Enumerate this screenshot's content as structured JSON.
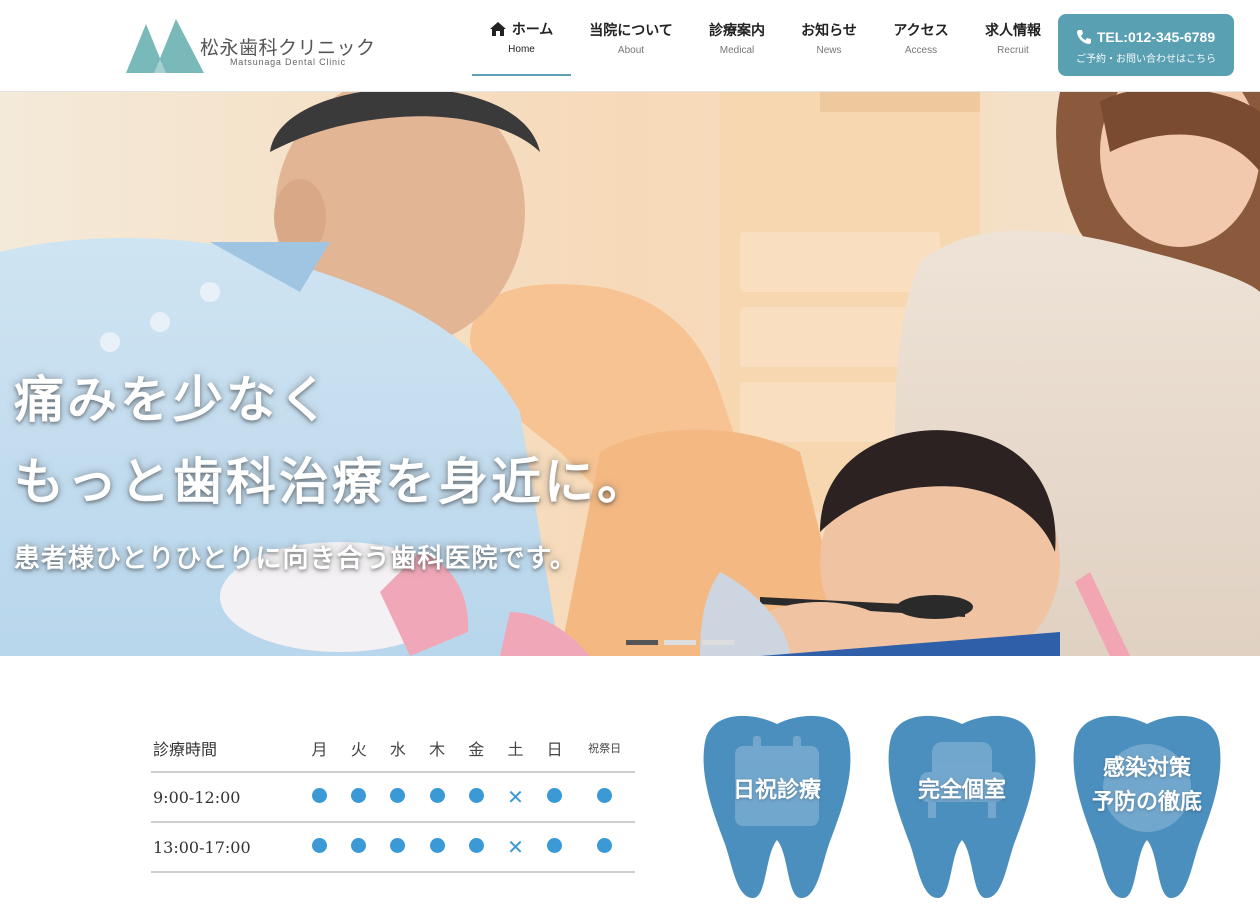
{
  "logo": {
    "name": "松永歯科クリニック",
    "sub": "Matsunaga Dental Clinic"
  },
  "nav": [
    {
      "jp": "ホーム",
      "en": "Home"
    },
    {
      "jp": "当院について",
      "en": "About"
    },
    {
      "jp": "診療案内",
      "en": "Medical"
    },
    {
      "jp": "お知らせ",
      "en": "News"
    },
    {
      "jp": "アクセス",
      "en": "Access"
    },
    {
      "jp": "求人情報",
      "en": "Recruit"
    }
  ],
  "tel": {
    "main": "TEL:012-345-6789",
    "sub": "ご予約・お問い合わせはこちら"
  },
  "hero": {
    "line1": "痛みを少なく",
    "line2": "もっと歯科治療を身近に。",
    "sub": "患者様ひとりひとりに向き合う歯科医院です。",
    "slides": 3,
    "active_slide": 1
  },
  "schedule": {
    "header": "診療時間",
    "days": [
      "月",
      "火",
      "水",
      "木",
      "金",
      "土",
      "日",
      "祝祭日"
    ],
    "rows": [
      {
        "time": "9:00-12:00",
        "open": [
          true,
          true,
          true,
          true,
          true,
          false,
          true,
          true
        ]
      },
      {
        "time": "13:00-17:00",
        "open": [
          true,
          true,
          true,
          true,
          true,
          false,
          true,
          true
        ]
      }
    ]
  },
  "features": [
    {
      "lines": [
        "日祝診療"
      ],
      "icon": "calendar-icon"
    },
    {
      "lines": [
        "完全個室"
      ],
      "icon": "chair-icon"
    },
    {
      "lines": [
        "感染対策",
        "予防の徹底"
      ],
      "icon": "shield-icon"
    }
  ],
  "colors": {
    "accent": "#59a0b3",
    "logo": "#79b9b9",
    "tooth": "#4b8fbf",
    "schedule_mark": "#3b9ad6"
  }
}
